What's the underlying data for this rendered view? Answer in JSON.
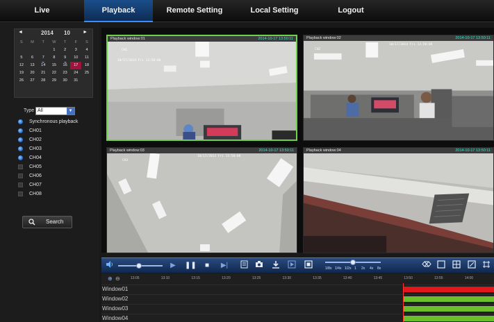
{
  "nav": {
    "tabs": [
      {
        "label": "Live",
        "active": false
      },
      {
        "label": "Playback",
        "active": true
      },
      {
        "label": "Remote Setting",
        "active": false
      },
      {
        "label": "Local Setting",
        "active": false
      },
      {
        "label": "Logout",
        "active": false
      }
    ]
  },
  "calendar": {
    "prev_icon": "◄",
    "next_icon": "►",
    "year": "2014",
    "month": "10",
    "weekdays": [
      "S",
      "M",
      "T",
      "W",
      "T",
      "F",
      "S"
    ],
    "days": [
      "",
      "",
      "",
      "1",
      "2",
      "3",
      "4",
      "5",
      "6",
      "7",
      "8",
      "9",
      "10",
      "11",
      "12",
      "13",
      "14",
      "15",
      "16",
      "17",
      "18",
      "19",
      "20",
      "21",
      "22",
      "23",
      "24",
      "25",
      "26",
      "27",
      "28",
      "29",
      "30",
      "31",
      ""
    ],
    "selected_day": "17",
    "marked_days": [
      "14",
      "16"
    ]
  },
  "filter": {
    "type_label": "Type",
    "type_value": "All",
    "type_options": [
      "All"
    ]
  },
  "channels": [
    {
      "label": "Synchronous playback",
      "checked": true
    },
    {
      "label": "CH01",
      "checked": true
    },
    {
      "label": "CH02",
      "checked": true
    },
    {
      "label": "CH03",
      "checked": true
    },
    {
      "label": "CH04",
      "checked": true
    },
    {
      "label": "CH05",
      "checked": false
    },
    {
      "label": "CH06",
      "checked": false
    },
    {
      "label": "CH07",
      "checked": false
    },
    {
      "label": "CH08",
      "checked": false
    }
  ],
  "search": {
    "label": "Search",
    "icon": "search-icon"
  },
  "windows": [
    {
      "title": "Playback window:01",
      "time": "2014-10-17 13:50:11",
      "osd_date": "10/17/2014 Fri 13:50:08",
      "osd_ch": "CH1",
      "selected": true
    },
    {
      "title": "Playback window:02",
      "time": "2014-10-17 13:50:11",
      "osd_date": "10/17/2014 Fri 13:50:08",
      "osd_ch": "CH2",
      "selected": false
    },
    {
      "title": "Playback window:03",
      "time": "2014-10-17 13:50:11",
      "osd_date": "10/17/2014 Fri 13:50:08",
      "osd_ch": "CH3",
      "selected": false
    },
    {
      "title": "Playback window:04",
      "time": "2014-10-17 13:50:11",
      "osd_date": "",
      "osd_ch": "",
      "selected": false
    }
  ],
  "controls": {
    "icons": [
      "volume-icon",
      "play-icon",
      "pause-icon",
      "stop-icon",
      "step-forward-icon",
      "clip-icon",
      "snapshot-icon",
      "download-icon",
      "export-icon",
      "fullscreen-icon",
      "fit-window-icon",
      "single-view-icon",
      "quad-view-icon",
      "aspect-icon",
      "crop-icon"
    ],
    "volume_level": 0.45,
    "speed_labels": [
      "1/8x",
      "1/4x",
      "1/2x",
      "1",
      "2x",
      "4x",
      "8x"
    ],
    "speed_level": 0.5
  },
  "timeline": {
    "zoom_icons": [
      "zoom-in-icon",
      "zoom-out-icon"
    ],
    "ticks": [
      "13:05",
      "13:10",
      "13:15",
      "13:20",
      "13:25",
      "13:30",
      "13:35",
      "13:40",
      "13:45",
      "13:50",
      "13:55",
      "14:00"
    ],
    "rows": [
      {
        "label": "Window01",
        "color": "#e2171c"
      },
      {
        "label": "Window02",
        "color": "#6abf2a"
      },
      {
        "label": "Window03",
        "color": "#6abf2a"
      },
      {
        "label": "Window04",
        "color": "#6abf2a"
      }
    ],
    "cursor_time": "13:50"
  }
}
